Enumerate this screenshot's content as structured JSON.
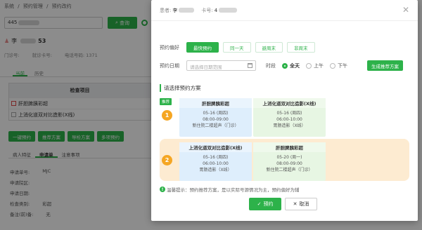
{
  "bg": {
    "breadcrumb": [
      "系统",
      "/",
      "预约管理",
      "/",
      "预约改约"
    ],
    "search_value": "445",
    "query_label": "查询",
    "patient_name": "李",
    "patient_age": "53",
    "id_labels": [
      "门诊号:",
      "就诊卡号:",
      "电话号码: 1371"
    ],
    "tabs": [
      "当前",
      "历史"
    ],
    "table_header": "检查项目",
    "rows": [
      "肝胆脾胰彩超",
      "上消化道双对比造影(X线)"
    ],
    "actions": [
      "一键预约",
      "推荐方案",
      "导检方案",
      "多项预约"
    ],
    "subtabs": [
      "病人特征",
      "申请单",
      "注意事项"
    ],
    "fields": [
      {
        "label": "申请单号:",
        "value": "MJC"
      },
      {
        "label": "申请院区:",
        "value": ""
      },
      {
        "label": "申请日期:",
        "value": ""
      },
      {
        "label": "检查类别:",
        "value": "彩超"
      },
      {
        "label": "备注(前)备:",
        "value": "无"
      }
    ]
  },
  "modal": {
    "patient_label": "患者:",
    "patient_name": "李",
    "card_label": "卡号:",
    "card_value": "4",
    "pref_label": "预约偏好",
    "prefs": [
      "最快预约",
      "同一天",
      "避周末",
      "非周末"
    ],
    "date_label": "预约日期",
    "date_placeholder": "请选择日期范围",
    "period_label": "时段",
    "periods": [
      "全天",
      "上午",
      "下午"
    ],
    "generate_label": "生成推荐方案",
    "section_title": "请选择预约方案",
    "recommend_badge": "推荐",
    "plans": [
      {
        "num": "1",
        "cards": [
          {
            "title": "肝胆脾胰彩超",
            "date": "05-16",
            "weekday": "(周四)",
            "time": "08:00-09:00",
            "place": "新住院二楼超声（门诊）"
          },
          {
            "title": "上消化道双对比造影(X线)",
            "date": "05-16",
            "weekday": "(周四)",
            "time": "06:00-10:00",
            "place": "胃肠造影（X线）"
          }
        ]
      },
      {
        "num": "2",
        "cards": [
          {
            "title": "上消化道双对比造影(X线)",
            "date": "05-16",
            "weekday": "(周四)",
            "time": "06:00-10:00",
            "place": "胃肠造影（X线）"
          },
          {
            "title": "肝胆脾胰彩超",
            "date": "05-20",
            "weekday": "(周一)",
            "time": "08:00-09:00",
            "place": "新住院二楼超声（门诊）"
          }
        ]
      }
    ],
    "tip": "温馨提示：预约推荐方案，是以实际号源情况为主，预约偏好为辅",
    "ok_label": "预约",
    "cancel_label": "取消"
  }
}
